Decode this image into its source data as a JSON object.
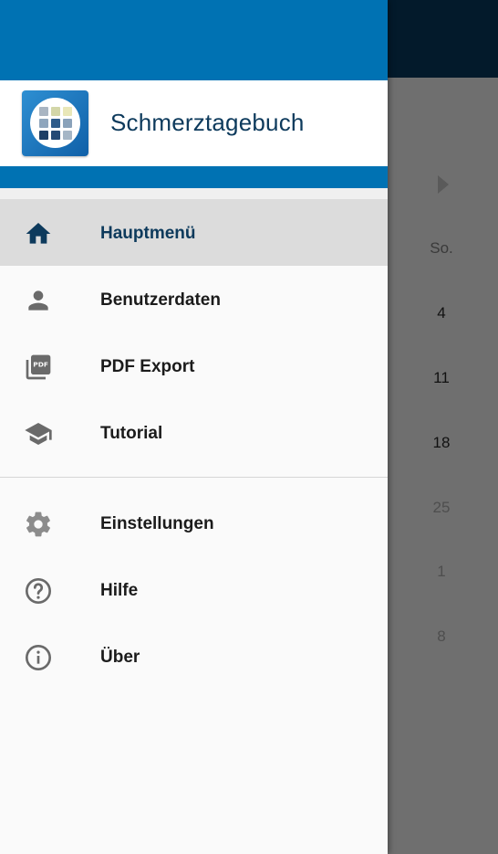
{
  "app": {
    "title": "Schmerztagebuch"
  },
  "drawer": {
    "primary_items": [
      {
        "label": "Hauptmenü",
        "icon": "home-icon",
        "active": true
      },
      {
        "label": "Benutzerdaten",
        "icon": "person-icon"
      },
      {
        "label": "PDF Export",
        "icon": "pdf-icon"
      },
      {
        "label": "Tutorial",
        "icon": "graduation-cap-icon"
      }
    ],
    "secondary_items": [
      {
        "label": "Einstellungen",
        "icon": "gear-icon"
      },
      {
        "label": "Hilfe",
        "icon": "help-icon"
      },
      {
        "label": "Über",
        "icon": "info-icon"
      }
    ]
  },
  "background": {
    "day_header": "So.",
    "days": [
      "4",
      "11",
      "18",
      "25",
      "1",
      "8"
    ]
  },
  "colors": {
    "primary": "#0072b3",
    "title_text": "#0d3a5c",
    "active_item_bg": "#dcdcdc",
    "scrim": "#6f6f6f"
  }
}
